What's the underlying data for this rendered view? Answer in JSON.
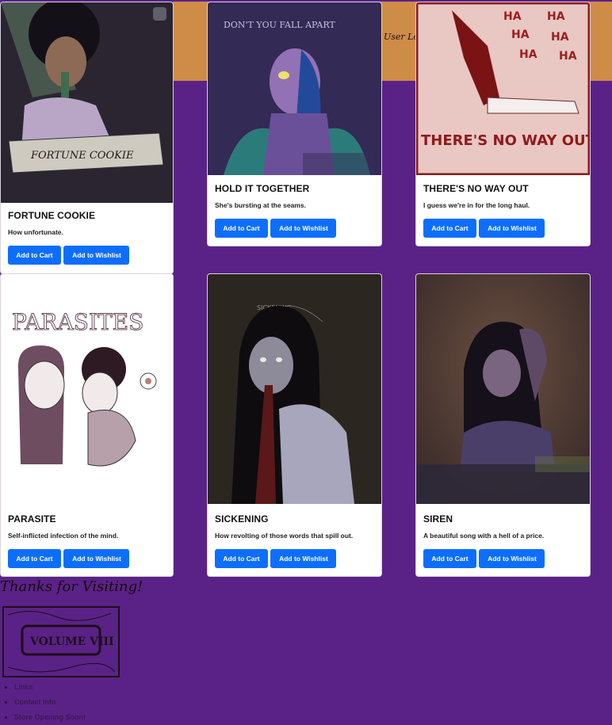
{
  "header": {
    "user_login": "User Login"
  },
  "products": [
    {
      "title": "FORTUNE COOKIE",
      "description": "How unfortunate.",
      "cart_label": "Add to Cart",
      "wishlist_label": "Add to Wishlist",
      "art_text": "FORTUNE COOKIE"
    },
    {
      "title": "HOLD IT TOGETHER",
      "description": "She's bursting at the seams.",
      "cart_label": "Add to Cart",
      "wishlist_label": "Add to Wishlist",
      "art_text": "DON'T YOU FALL APART"
    },
    {
      "title": "THERE'S NO WAY OUT",
      "description": "I guess we're in for the long haul.",
      "cart_label": "Add to Cart",
      "wishlist_label": "Add to Wishlist",
      "art_text": "THERE'S NO WAY OUT"
    },
    {
      "title": "PARASITE",
      "description": "Self-inflicted infection of the mind.",
      "cart_label": "Add to Cart",
      "wishlist_label": "Add to Wishlist",
      "art_text": "PARASITES"
    },
    {
      "title": "SICKENING",
      "description": "How revolting of those words that spill out.",
      "cart_label": "Add to Cart",
      "wishlist_label": "Add to Wishlist",
      "art_text": "SICKENING"
    },
    {
      "title": "SIREN",
      "description": "A beautiful song with a hell of a price.",
      "cart_label": "Add to Cart",
      "wishlist_label": "Add to Wishlist"
    }
  ],
  "footer": {
    "title": "Thanks for Visiting!",
    "logo_text": "VOLUME VIII",
    "links": [
      "Links",
      "Contact Info",
      "Store Opening Soon!"
    ]
  },
  "colors": {
    "page_bg": "#5a2286",
    "header_bar": "#cf8c47",
    "button": "#0d6efd"
  }
}
